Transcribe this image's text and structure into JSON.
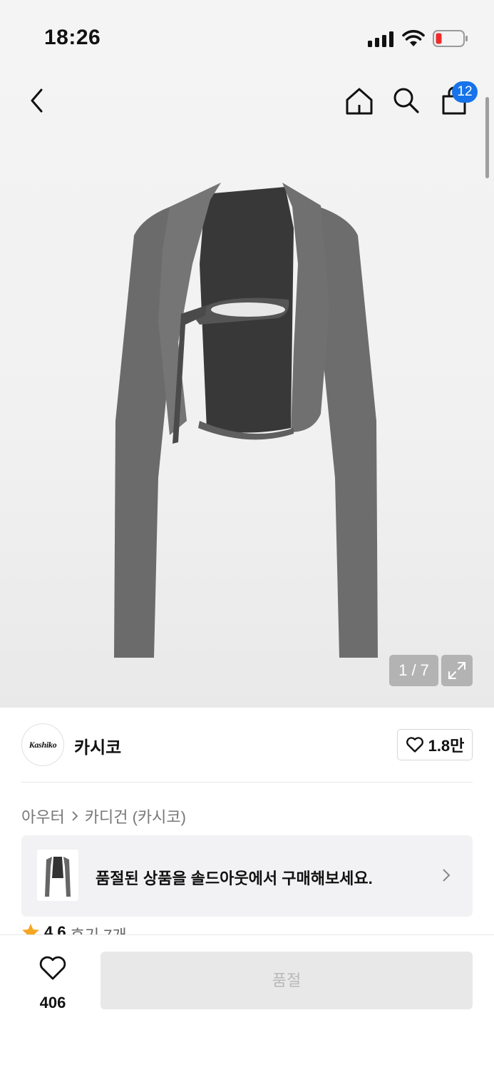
{
  "status_bar": {
    "time": "18:26"
  },
  "nav": {
    "cart_count": "12"
  },
  "gallery": {
    "counter": "1 / 7"
  },
  "brand": {
    "logo_text": "Kashiko",
    "name": "카시코",
    "likes": "1.8만"
  },
  "breadcrumb": {
    "category": "아우터",
    "subcategory": "카디건 (카시코)"
  },
  "soldout_banner": {
    "text": "품절된 상품을 솔드아웃에서 구매해보세요."
  },
  "rating": {
    "score": "4.6",
    "reviews": "후기 7개"
  },
  "bottom": {
    "wish_count": "406",
    "buy_label": "품절"
  },
  "colors": {
    "accent": "#1673ea",
    "garment": "#676767",
    "garment_inner": "#3a3a3a"
  }
}
